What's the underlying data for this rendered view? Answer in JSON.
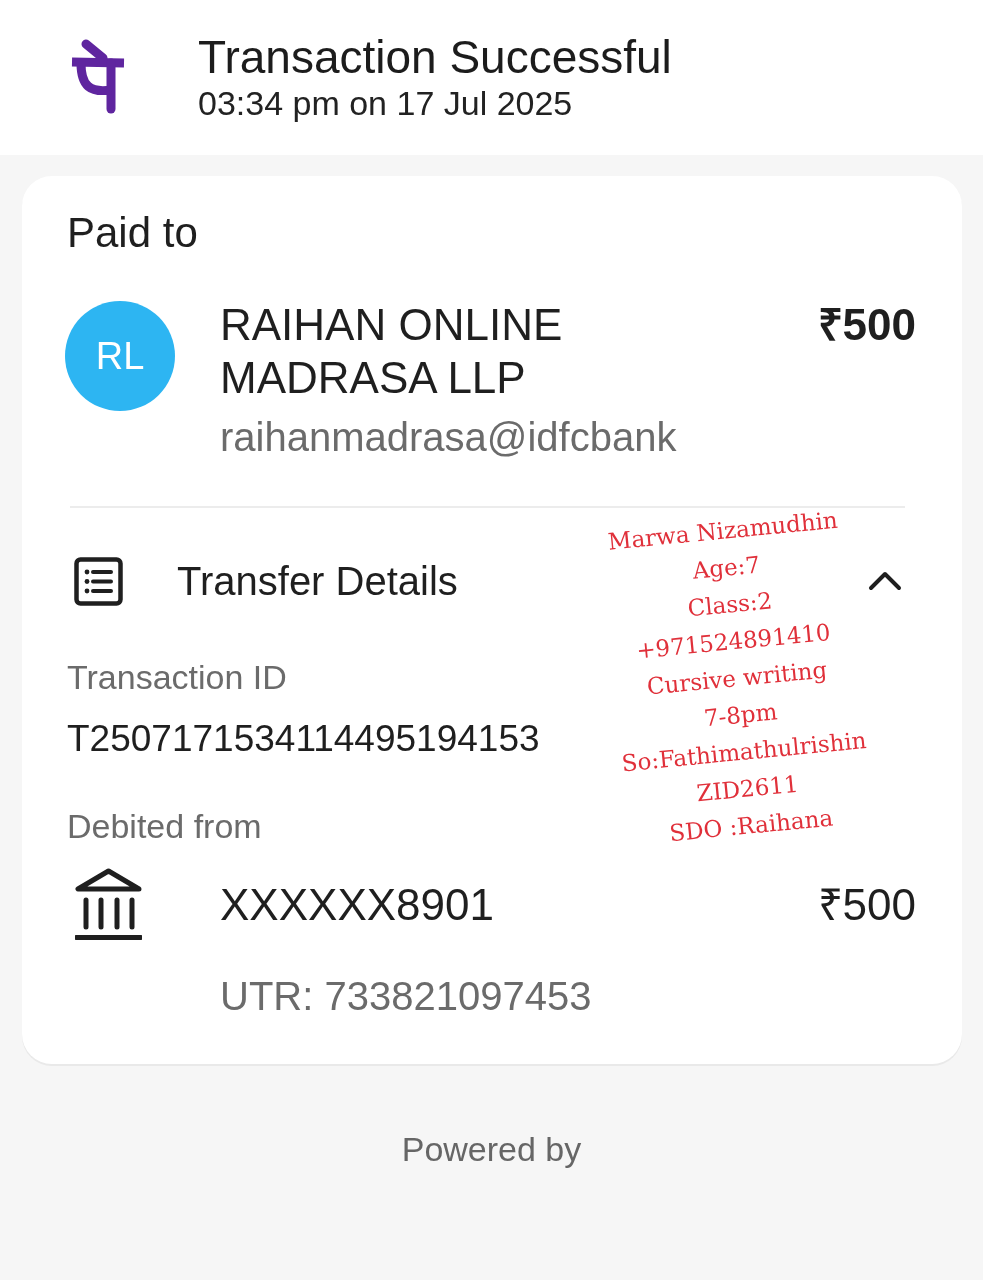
{
  "header": {
    "title": "Transaction Successful",
    "subtitle": "03:34 pm on 17 Jul 2025"
  },
  "payment": {
    "label": "Paid to",
    "initials": "RL",
    "name": "RAIHAN ONLINE MADRASA LLP",
    "amount": "₹500",
    "upi_id": "raihanmadrasa@idfcbank"
  },
  "transfer_details": {
    "title": "Transfer Details",
    "expanded": true,
    "transaction_id": {
      "label": "Transaction ID",
      "value": "T2507171534114495194153"
    },
    "debit": {
      "label": "Debited from",
      "account": "XXXXXX8901",
      "amount": "₹500",
      "utr": "UTR: 733821097453"
    }
  },
  "footer": {
    "text": "Powered by"
  },
  "annotation": {
    "lines": [
      "Marwa Nizamudhin",
      "Age:7",
      "Class:2",
      "+971524891410",
      "Cursive writing",
      "7-8pm",
      "So:Fathimathulrishin",
      "ZID2611",
      "SDO :Raihana"
    ]
  }
}
